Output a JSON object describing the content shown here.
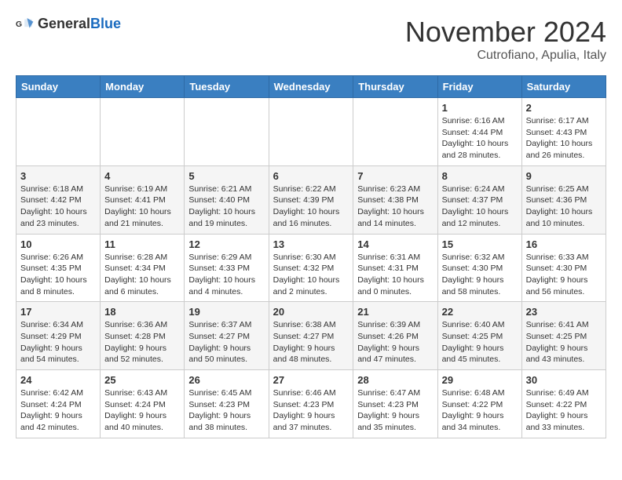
{
  "header": {
    "logo_general": "General",
    "logo_blue": "Blue",
    "month": "November 2024",
    "location": "Cutrofiano, Apulia, Italy"
  },
  "weekdays": [
    "Sunday",
    "Monday",
    "Tuesday",
    "Wednesday",
    "Thursday",
    "Friday",
    "Saturday"
  ],
  "weeks": [
    [
      {
        "day": "",
        "info": ""
      },
      {
        "day": "",
        "info": ""
      },
      {
        "day": "",
        "info": ""
      },
      {
        "day": "",
        "info": ""
      },
      {
        "day": "",
        "info": ""
      },
      {
        "day": "1",
        "info": "Sunrise: 6:16 AM\nSunset: 4:44 PM\nDaylight: 10 hours and 28 minutes."
      },
      {
        "day": "2",
        "info": "Sunrise: 6:17 AM\nSunset: 4:43 PM\nDaylight: 10 hours and 26 minutes."
      }
    ],
    [
      {
        "day": "3",
        "info": "Sunrise: 6:18 AM\nSunset: 4:42 PM\nDaylight: 10 hours and 23 minutes."
      },
      {
        "day": "4",
        "info": "Sunrise: 6:19 AM\nSunset: 4:41 PM\nDaylight: 10 hours and 21 minutes."
      },
      {
        "day": "5",
        "info": "Sunrise: 6:21 AM\nSunset: 4:40 PM\nDaylight: 10 hours and 19 minutes."
      },
      {
        "day": "6",
        "info": "Sunrise: 6:22 AM\nSunset: 4:39 PM\nDaylight: 10 hours and 16 minutes."
      },
      {
        "day": "7",
        "info": "Sunrise: 6:23 AM\nSunset: 4:38 PM\nDaylight: 10 hours and 14 minutes."
      },
      {
        "day": "8",
        "info": "Sunrise: 6:24 AM\nSunset: 4:37 PM\nDaylight: 10 hours and 12 minutes."
      },
      {
        "day": "9",
        "info": "Sunrise: 6:25 AM\nSunset: 4:36 PM\nDaylight: 10 hours and 10 minutes."
      }
    ],
    [
      {
        "day": "10",
        "info": "Sunrise: 6:26 AM\nSunset: 4:35 PM\nDaylight: 10 hours and 8 minutes."
      },
      {
        "day": "11",
        "info": "Sunrise: 6:28 AM\nSunset: 4:34 PM\nDaylight: 10 hours and 6 minutes."
      },
      {
        "day": "12",
        "info": "Sunrise: 6:29 AM\nSunset: 4:33 PM\nDaylight: 10 hours and 4 minutes."
      },
      {
        "day": "13",
        "info": "Sunrise: 6:30 AM\nSunset: 4:32 PM\nDaylight: 10 hours and 2 minutes."
      },
      {
        "day": "14",
        "info": "Sunrise: 6:31 AM\nSunset: 4:31 PM\nDaylight: 10 hours and 0 minutes."
      },
      {
        "day": "15",
        "info": "Sunrise: 6:32 AM\nSunset: 4:30 PM\nDaylight: 9 hours and 58 minutes."
      },
      {
        "day": "16",
        "info": "Sunrise: 6:33 AM\nSunset: 4:30 PM\nDaylight: 9 hours and 56 minutes."
      }
    ],
    [
      {
        "day": "17",
        "info": "Sunrise: 6:34 AM\nSunset: 4:29 PM\nDaylight: 9 hours and 54 minutes."
      },
      {
        "day": "18",
        "info": "Sunrise: 6:36 AM\nSunset: 4:28 PM\nDaylight: 9 hours and 52 minutes."
      },
      {
        "day": "19",
        "info": "Sunrise: 6:37 AM\nSunset: 4:27 PM\nDaylight: 9 hours and 50 minutes."
      },
      {
        "day": "20",
        "info": "Sunrise: 6:38 AM\nSunset: 4:27 PM\nDaylight: 9 hours and 48 minutes."
      },
      {
        "day": "21",
        "info": "Sunrise: 6:39 AM\nSunset: 4:26 PM\nDaylight: 9 hours and 47 minutes."
      },
      {
        "day": "22",
        "info": "Sunrise: 6:40 AM\nSunset: 4:25 PM\nDaylight: 9 hours and 45 minutes."
      },
      {
        "day": "23",
        "info": "Sunrise: 6:41 AM\nSunset: 4:25 PM\nDaylight: 9 hours and 43 minutes."
      }
    ],
    [
      {
        "day": "24",
        "info": "Sunrise: 6:42 AM\nSunset: 4:24 PM\nDaylight: 9 hours and 42 minutes."
      },
      {
        "day": "25",
        "info": "Sunrise: 6:43 AM\nSunset: 4:24 PM\nDaylight: 9 hours and 40 minutes."
      },
      {
        "day": "26",
        "info": "Sunrise: 6:45 AM\nSunset: 4:23 PM\nDaylight: 9 hours and 38 minutes."
      },
      {
        "day": "27",
        "info": "Sunrise: 6:46 AM\nSunset: 4:23 PM\nDaylight: 9 hours and 37 minutes."
      },
      {
        "day": "28",
        "info": "Sunrise: 6:47 AM\nSunset: 4:23 PM\nDaylight: 9 hours and 35 minutes."
      },
      {
        "day": "29",
        "info": "Sunrise: 6:48 AM\nSunset: 4:22 PM\nDaylight: 9 hours and 34 minutes."
      },
      {
        "day": "30",
        "info": "Sunrise: 6:49 AM\nSunset: 4:22 PM\nDaylight: 9 hours and 33 minutes."
      }
    ]
  ]
}
